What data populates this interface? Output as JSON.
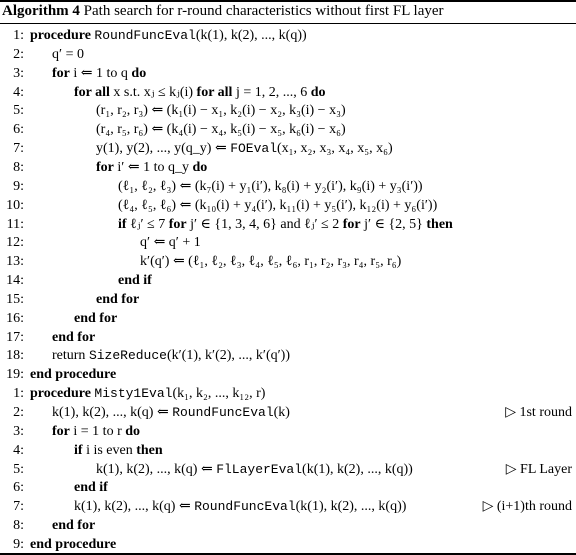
{
  "caption": {
    "label": "Algorithm 4",
    "text": " Path search for r-round characteristics without first FL layer"
  },
  "procedures": [
    {
      "name": "RoundFuncEval",
      "lines": [
        {
          "num": "1:",
          "indent": 0,
          "text": "procedure RoundFuncEval(k(1), k(2), ..., k(q))",
          "comment": ""
        },
        {
          "num": "2:",
          "indent": 1,
          "text": "q′ = 0",
          "comment": ""
        },
        {
          "num": "3:",
          "indent": 1,
          "text": "for i ⇐ 1 to q do",
          "comment": ""
        },
        {
          "num": "4:",
          "indent": 2,
          "text": "for all x s.t. xⱼ ≤ kⱼ(i) for all j = 1, 2, ..., 6 do",
          "comment": ""
        },
        {
          "num": "5:",
          "indent": 3,
          "text": "(r₁, r₂, r₃) ⇐ (k₁(i) − x₁, k₂(i) − x₂, k₃(i) − x₃)",
          "comment": ""
        },
        {
          "num": "6:",
          "indent": 3,
          "text": "(r₄, r₅, r₆) ⇐ (k₄(i) − x₄, k₅(i) − x₅, k₆(i) − x₆)",
          "comment": ""
        },
        {
          "num": "7:",
          "indent": 3,
          "text": "y(1), y(2), ..., y(q_y) ⇐ FOEval(x₁, x₂, x₃, x₄, x₅, x₆)",
          "comment": ""
        },
        {
          "num": "8:",
          "indent": 3,
          "text": "for i′ ⇐ 1 to q_y do",
          "comment": ""
        },
        {
          "num": "9:",
          "indent": 4,
          "text": "(ℓ₁, ℓ₂, ℓ₃) ⇐ (k₇(i) + y₁(i′), k₈(i) + y₂(i′), k₉(i) + y₃(i′))",
          "comment": ""
        },
        {
          "num": "10:",
          "indent": 4,
          "text": "(ℓ₄, ℓ₅, ℓ₆) ⇐ (k₁₀(i) + y₄(i′), k₁₁(i) + y₅(i′), k₁₂(i) + y₆(i′))",
          "comment": ""
        },
        {
          "num": "11:",
          "indent": 4,
          "text": "if ℓⱼ′ ≤ 7 for j′ ∈ {1, 3, 4, 6} and ℓⱼ′ ≤ 2 for j′ ∈ {2, 5} then",
          "comment": ""
        },
        {
          "num": "12:",
          "indent": 5,
          "text": "q′ ⇐ q′ + 1",
          "comment": ""
        },
        {
          "num": "13:",
          "indent": 5,
          "text": "k′(q′) ⇐ (ℓ₁, ℓ₂, ℓ₃, ℓ₄, ℓ₅, ℓ₆, r₁, r₂, r₃, r₄, r₅, r₆)",
          "comment": ""
        },
        {
          "num": "14:",
          "indent": 4,
          "text": "end if",
          "comment": ""
        },
        {
          "num": "15:",
          "indent": 3,
          "text": "end for",
          "comment": ""
        },
        {
          "num": "16:",
          "indent": 2,
          "text": "end for",
          "comment": ""
        },
        {
          "num": "17:",
          "indent": 1,
          "text": "end for",
          "comment": ""
        },
        {
          "num": "18:",
          "indent": 1,
          "text": "return SizeReduce(k′(1), k′(2), ..., k′(q′))",
          "comment": ""
        },
        {
          "num": "19:",
          "indent": 0,
          "text": "end procedure",
          "comment": ""
        }
      ]
    },
    {
      "name": "Misty1Eval",
      "lines": [
        {
          "num": "1:",
          "indent": 0,
          "text": "procedure Misty1Eval(k₁, k₂, ..., k₁₂, r)",
          "comment": ""
        },
        {
          "num": "2:",
          "indent": 1,
          "text": "k(1), k(2), ..., k(q) ⇐ RoundFuncEval(k)",
          "comment": "▷ 1st round"
        },
        {
          "num": "3:",
          "indent": 1,
          "text": "for i = 1 to r do",
          "comment": ""
        },
        {
          "num": "4:",
          "indent": 2,
          "text": "if i is even then",
          "comment": ""
        },
        {
          "num": "5:",
          "indent": 3,
          "text": "k(1), k(2), ..., k(q) ⇐ FlLayerEval(k(1), k(2), ..., k(q))",
          "comment": "▷ FL Layer"
        },
        {
          "num": "6:",
          "indent": 2,
          "text": "end if",
          "comment": ""
        },
        {
          "num": "7:",
          "indent": 2,
          "text": "k(1), k(2), ..., k(q) ⇐ RoundFuncEval(k(1), k(2), ..., k(q))",
          "comment": "▷ (i+1)th round"
        },
        {
          "num": "8:",
          "indent": 1,
          "text": "end for",
          "comment": ""
        },
        {
          "num": "9:",
          "indent": 0,
          "text": "end procedure",
          "comment": ""
        }
      ]
    }
  ],
  "keywords": [
    "procedure",
    "end procedure",
    "for",
    "for all",
    "do",
    "if",
    "then",
    "end if",
    "end for"
  ],
  "function_names": [
    "RoundFuncEval",
    "FOEval",
    "SizeReduce",
    "Misty1Eval",
    "FlLayerEval"
  ]
}
